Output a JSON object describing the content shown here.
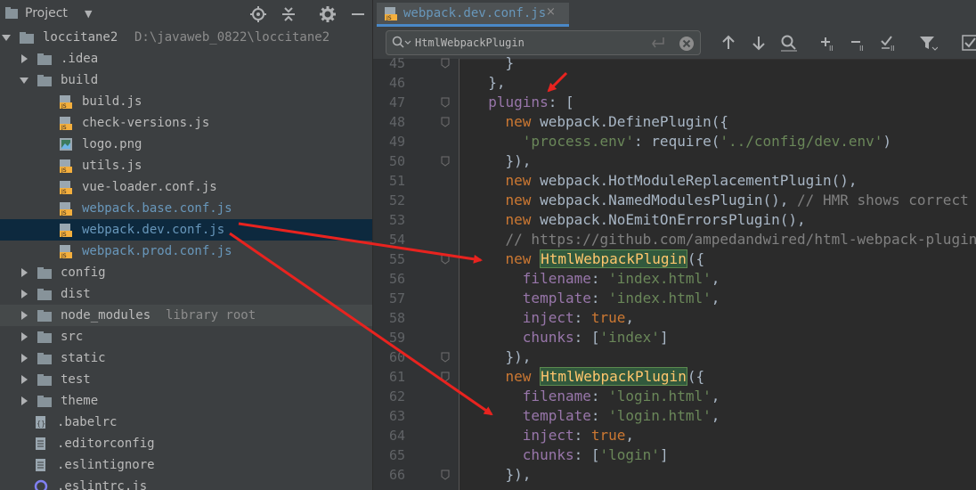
{
  "project_panel": {
    "title": "Project",
    "tree": [
      {
        "label": "loccitane2",
        "path": "D:\\javaweb_0822\\loccitane2",
        "kind": "root",
        "expanded": true,
        "depth": 0
      },
      {
        "label": ".idea",
        "kind": "folder",
        "expanded": false,
        "depth": 1
      },
      {
        "label": "build",
        "kind": "folder",
        "expanded": true,
        "depth": 1
      },
      {
        "label": "build.js",
        "kind": "js",
        "depth": 2
      },
      {
        "label": "check-versions.js",
        "kind": "js",
        "depth": 2
      },
      {
        "label": "logo.png",
        "kind": "png",
        "depth": 2
      },
      {
        "label": "utils.js",
        "kind": "js",
        "depth": 2
      },
      {
        "label": "vue-loader.conf.js",
        "kind": "js",
        "depth": 2
      },
      {
        "label": "webpack.base.conf.js",
        "kind": "js",
        "depth": 2,
        "color": "blue"
      },
      {
        "label": "webpack.dev.conf.js",
        "kind": "js",
        "depth": 2,
        "color": "blue",
        "selected": true
      },
      {
        "label": "webpack.prod.conf.js",
        "kind": "js",
        "depth": 2,
        "color": "blue"
      },
      {
        "label": "config",
        "kind": "folder",
        "expanded": false,
        "depth": 1
      },
      {
        "label": "dist",
        "kind": "folder",
        "expanded": false,
        "depth": 1
      },
      {
        "label": "node_modules",
        "kind": "folder",
        "expanded": false,
        "depth": 1,
        "suffix": "library root"
      },
      {
        "label": "src",
        "kind": "folder",
        "expanded": false,
        "depth": 1
      },
      {
        "label": "static",
        "kind": "folder",
        "expanded": false,
        "depth": 1
      },
      {
        "label": "test",
        "kind": "folder",
        "expanded": false,
        "depth": 1
      },
      {
        "label": "theme",
        "kind": "folder",
        "expanded": false,
        "depth": 1
      },
      {
        "label": ".babelrc",
        "kind": "config",
        "depth": 1
      },
      {
        "label": ".editorconfig",
        "kind": "text",
        "depth": 1
      },
      {
        "label": ".eslintignore",
        "kind": "text",
        "depth": 1
      },
      {
        "label": ".eslintrc.js",
        "kind": "eslint",
        "depth": 1
      }
    ]
  },
  "editor": {
    "tab": {
      "label": "webpack.dev.conf.js",
      "close": "×",
      "icon": "js-file-icon"
    },
    "search": {
      "value": "HtmlWebpackPlugin"
    },
    "colors": {
      "keyword": "#cc7832",
      "string": "#6a8759",
      "function": "#ffc66d",
      "property": "#9876aa",
      "comment": "#808080",
      "match_bg": "#32593d"
    },
    "lines": [
      {
        "n": "45",
        "tokens": [
          [
            "p",
            "    }"
          ]
        ]
      },
      {
        "n": "46",
        "tokens": [
          [
            "p",
            "  },"
          ]
        ]
      },
      {
        "n": "47",
        "tokens": [
          [
            "prop",
            "  plugins"
          ],
          [
            "p",
            ": ["
          ]
        ]
      },
      {
        "n": "48",
        "tokens": [
          [
            "kw",
            "    new "
          ],
          [
            "p",
            "webpack."
          ],
          [
            "p",
            "DefinePlugin({"
          ]
        ]
      },
      {
        "n": "49",
        "tokens": [
          [
            "str",
            "      'process.env'"
          ],
          [
            "p",
            ": "
          ],
          [
            "p",
            "require("
          ],
          [
            "str",
            "'../config/dev.env'"
          ],
          [
            "p",
            ")"
          ]
        ]
      },
      {
        "n": "50",
        "tokens": [
          [
            "p",
            "    }),"
          ]
        ]
      },
      {
        "n": "51",
        "tokens": [
          [
            "kw",
            "    new "
          ],
          [
            "p",
            "webpack."
          ],
          [
            "p",
            "HotModuleReplacementPlugin(),"
          ]
        ]
      },
      {
        "n": "52",
        "tokens": [
          [
            "kw",
            "    new "
          ],
          [
            "p",
            "webpack."
          ],
          [
            "p",
            "NamedModulesPlugin(), "
          ],
          [
            "cm",
            "// HMR shows correct"
          ]
        ]
      },
      {
        "n": "53",
        "tokens": [
          [
            "kw",
            "    new "
          ],
          [
            "p",
            "webpack."
          ],
          [
            "p",
            "NoEmitOnErrorsPlugin(),"
          ]
        ]
      },
      {
        "n": "54",
        "tokens": [
          [
            "cm",
            "    // https://github.com/ampedandwired/html-webpack-plugin"
          ]
        ]
      },
      {
        "n": "55",
        "tokens": [
          [
            "kw",
            "    new "
          ],
          [
            "hl",
            "HtmlWebpackPlugin"
          ],
          [
            "p",
            "({"
          ]
        ]
      },
      {
        "n": "56",
        "tokens": [
          [
            "prop",
            "      filename"
          ],
          [
            "p",
            ": "
          ],
          [
            "str",
            "'index.html'"
          ],
          [
            "p",
            ","
          ]
        ]
      },
      {
        "n": "57",
        "tokens": [
          [
            "prop",
            "      template"
          ],
          [
            "p",
            ": "
          ],
          [
            "str",
            "'index.html'"
          ],
          [
            "p",
            ","
          ]
        ]
      },
      {
        "n": "58",
        "tokens": [
          [
            "prop",
            "      inject"
          ],
          [
            "p",
            ": "
          ],
          [
            "kw",
            "true"
          ],
          [
            "p",
            ","
          ]
        ]
      },
      {
        "n": "59",
        "tokens": [
          [
            "prop",
            "      chunks"
          ],
          [
            "p",
            ": ["
          ],
          [
            "str",
            "'index'"
          ],
          [
            "p",
            "]"
          ]
        ]
      },
      {
        "n": "60",
        "tokens": [
          [
            "p",
            "    }),"
          ]
        ]
      },
      {
        "n": "61",
        "tokens": [
          [
            "kw",
            "    new "
          ],
          [
            "hl",
            "HtmlWebpackPlugin"
          ],
          [
            "p",
            "({"
          ]
        ]
      },
      {
        "n": "62",
        "tokens": [
          [
            "prop",
            "      filename"
          ],
          [
            "p",
            ": "
          ],
          [
            "str",
            "'login.html'"
          ],
          [
            "p",
            ","
          ]
        ]
      },
      {
        "n": "63",
        "tokens": [
          [
            "prop",
            "      template"
          ],
          [
            "p",
            ": "
          ],
          [
            "str",
            "'login.html'"
          ],
          [
            "p",
            ","
          ]
        ]
      },
      {
        "n": "64",
        "tokens": [
          [
            "prop",
            "      inject"
          ],
          [
            "p",
            ": "
          ],
          [
            "kw",
            "true"
          ],
          [
            "p",
            ","
          ]
        ]
      },
      {
        "n": "65",
        "tokens": [
          [
            "prop",
            "      chunks"
          ],
          [
            "p",
            ": ["
          ],
          [
            "str",
            "'login'"
          ],
          [
            "p",
            "]"
          ]
        ]
      },
      {
        "n": "66",
        "tokens": [
          [
            "p",
            "    }),"
          ]
        ]
      }
    ]
  }
}
